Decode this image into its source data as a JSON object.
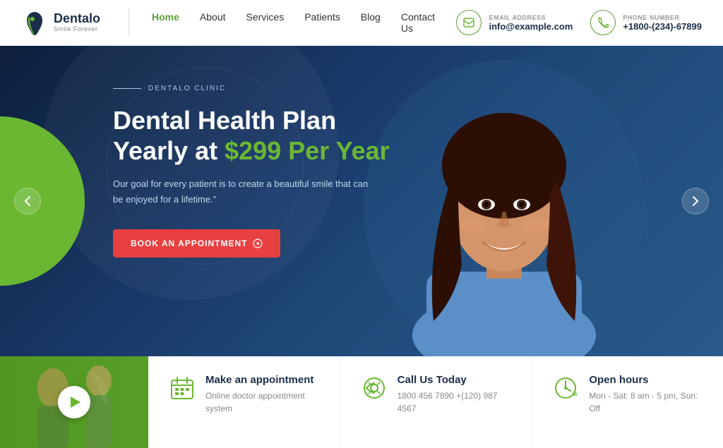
{
  "site": {
    "name": "Dentalo",
    "tagline": "Smile Forever"
  },
  "nav": {
    "items": [
      {
        "label": "Home",
        "active": true
      },
      {
        "label": "About",
        "active": false
      },
      {
        "label": "Services",
        "active": false
      },
      {
        "label": "Patients",
        "active": false
      },
      {
        "label": "Blog",
        "active": false
      },
      {
        "label": "Contact Us",
        "active": false
      }
    ]
  },
  "header": {
    "email_label": "EMAIL ADDRESS",
    "email_value": "info@example.com",
    "phone_label": "PHONE NUMBER",
    "phone_value": "+1800-(234)-67899"
  },
  "hero": {
    "pre_title": "DENTALO CLINIC",
    "title_line1": "Dental Health Plan",
    "title_line2": "Yearly at ",
    "title_highlight": "$299 Per Year",
    "description": "Our goal for every patient is to create a beautiful smile that can be enjoyed for a lifetime.\"",
    "cta_label": "BOOK AN APPOINTMENT"
  },
  "bottom_strip": {
    "items": [
      {
        "icon": "calendar",
        "title": "Make an appointment",
        "desc": "Online doctor appointment system"
      },
      {
        "icon": "phone",
        "title": "Call Us Today",
        "desc": "1800 456 7890 +(120) 987 4567"
      },
      {
        "icon": "clock",
        "title": "Open hours",
        "desc": "Mon - Sat: 8 am - 5 pm, Sun: Off"
      }
    ]
  }
}
